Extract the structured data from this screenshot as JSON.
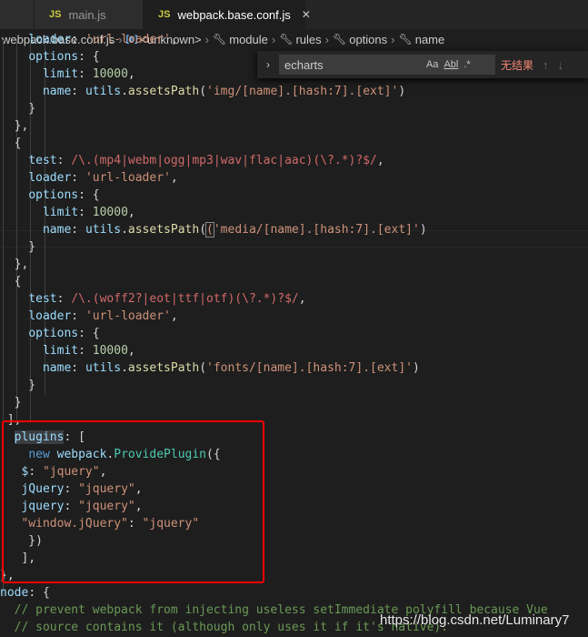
{
  "tabs": [
    {
      "icon": "JS",
      "label": "main.js",
      "active": false
    },
    {
      "icon": "JS",
      "label": "webpack.base.conf.js",
      "active": true,
      "close": "✕"
    }
  ],
  "breadcrumb": {
    "file": "webpack.base.conf.js",
    "symbol_icon": "[ø]",
    "items": [
      "<unknown>",
      "module",
      "rules",
      "options",
      "name"
    ]
  },
  "find_widget": {
    "query": "echarts",
    "match_case": "Aa",
    "whole_word": "Abl",
    "regex": ".*",
    "result": "无结果",
    "prev": "↑",
    "next": "↓"
  },
  "code_lines": [
    "    loader: 'url-loader',",
    "    options: {",
    "      limit: 10000,",
    "      name: utils.assetsPath('img/[name].[hash:7].[ext]')",
    "    }",
    "  },",
    "  {",
    "    test: /\\.(mp4|webm|ogg|mp3|wav|flac|aac)(\\?.*)?$/,",
    "    loader: 'url-loader',",
    "    options: {",
    "      limit: 10000,",
    "      name: utils.assetsPath('media/[name].[hash:7].[ext]')",
    "    }",
    "  },",
    "  {",
    "    test: /\\.(woff2?|eot|ttf|otf)(\\?.*)?$/,",
    "    loader: 'url-loader',",
    "    options: {",
    "      limit: 10000,",
    "      name: utils.assetsPath('fonts/[name].[hash:7].[ext]')",
    "    }",
    "  }",
    " ],",
    "  plugins: [",
    "    new webpack.ProvidePlugin({",
    "   $: \"jquery\",",
    "   jQuery: \"jquery\",",
    "   jquery: \"jquery\",",
    "   \"window.jQuery\": \"jquery\"",
    "    })",
    "   ],",
    "},",
    "node: {",
    "  // prevent webpack from injecting useless setImmediate polyfill because Vue",
    "  // source contains it (although only uses it if it's native)."
  ],
  "watermark": "https://blog.csdn.net/Luminary7"
}
